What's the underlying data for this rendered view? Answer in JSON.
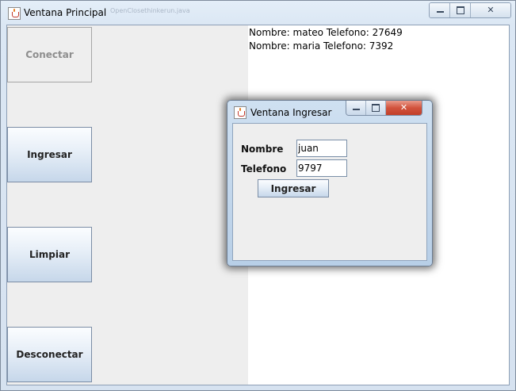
{
  "main_window": {
    "title": "Ventana Principal",
    "background_tab_text": "OpenClosethinkerun.java",
    "caption": {
      "minimize": "",
      "maximize": "",
      "close": "✕"
    }
  },
  "sidebar": {
    "conectar": {
      "label": "Conectar",
      "enabled": false
    },
    "ingresar": {
      "label": "Ingresar",
      "enabled": true
    },
    "limpiar": {
      "label": "Limpiar",
      "enabled": true
    },
    "desconectar": {
      "label": "Desconectar",
      "enabled": true
    }
  },
  "results": [
    "Nombre: mateo Telefono: 27649",
    "Nombre: maria  Telefono: 7392"
  ],
  "dialog": {
    "title": "Ventana Ingresar",
    "caption": {
      "minimize": "",
      "maximize": "",
      "close": "✕"
    },
    "fields": {
      "nombre": {
        "label": "Nombre",
        "value": "juan"
      },
      "telefono": {
        "label": "Telefono",
        "value": "9797"
      }
    },
    "submit_label": "Ingresar"
  },
  "colors": {
    "button_gradient_top": "#fbfdff",
    "button_gradient_bottom": "#c6d7ea",
    "panel_gray": "#eeeeee",
    "close_red": "#c13f29"
  }
}
